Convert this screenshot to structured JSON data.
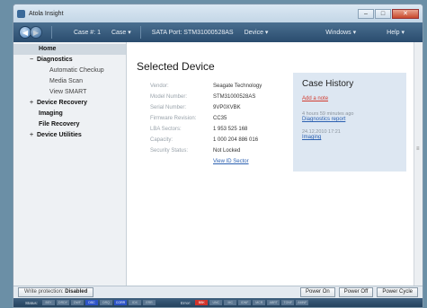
{
  "window": {
    "title": "Atola Insight"
  },
  "controls": {
    "minimize": "–",
    "maximize": "□",
    "close": "✕"
  },
  "toolbar": {
    "case_number": "Case #: 1",
    "case_menu": "Case ▾",
    "sata_port": "SATA Port: STM31000528AS",
    "device_menu": "Device ▾",
    "windows_menu": "Windows ▾",
    "help_menu": "Help ▾"
  },
  "sidebar": {
    "home": "Home",
    "diagnostics": "Diagnostics",
    "automatic_checkup": "Automatic Checkup",
    "media_scan": "Media Scan",
    "view_smart": "View SMART",
    "device_recovery": "Device Recovery",
    "imaging": "Imaging",
    "file_recovery": "File Recovery",
    "device_utilities": "Device Utilities",
    "expanded_glyph": "−",
    "collapsed_glyph": "+"
  },
  "main": {
    "title": "Selected Device",
    "details": [
      {
        "label": "Vendor:",
        "value": "Seagate Technology"
      },
      {
        "label": "Model Number:",
        "value": "STM31000528AS"
      },
      {
        "label": "Serial Number:",
        "value": "9VP0XVBK"
      },
      {
        "label": "Firmware Revision:",
        "value": "CC35"
      },
      {
        "label": "LBA Sectors:",
        "value": "1 953 525 168"
      },
      {
        "label": "Capacity:",
        "value": "1 000 204 886 016"
      },
      {
        "label": "Security Status:",
        "value": "Not Locked"
      }
    ],
    "view_id_sector": "View ID Sector"
  },
  "history": {
    "title": "Case History",
    "add_note": "Add a note",
    "entries": [
      {
        "time": "4 hours 59 minutes ago",
        "link": "Diagnostics report"
      },
      {
        "time": "24.12.2010 17:21",
        "link": "Imaging"
      }
    ]
  },
  "bottom": {
    "write_protection_label": "Write protection:",
    "write_protection_value": "Disabled",
    "power_on": "Power On",
    "power_off": "Power Off",
    "power_cycle": "Power Cycle"
  },
  "statusbar": {
    "status_label": "Status:",
    "status_regs": [
      "BSY",
      "DRDY",
      "DWF",
      "DSC",
      "DRQ",
      "CORR",
      "IDX",
      "ERR"
    ],
    "error_label": "Error:",
    "error_regs": [
      "BBK",
      "UNC",
      "MC",
      "IDNF",
      "MCR",
      "ABRT",
      "TONF",
      "AMNF"
    ],
    "colors": {
      "active_status": "#2e54c7",
      "active_error": "#d0342c",
      "inactive": "#5b7691"
    }
  }
}
